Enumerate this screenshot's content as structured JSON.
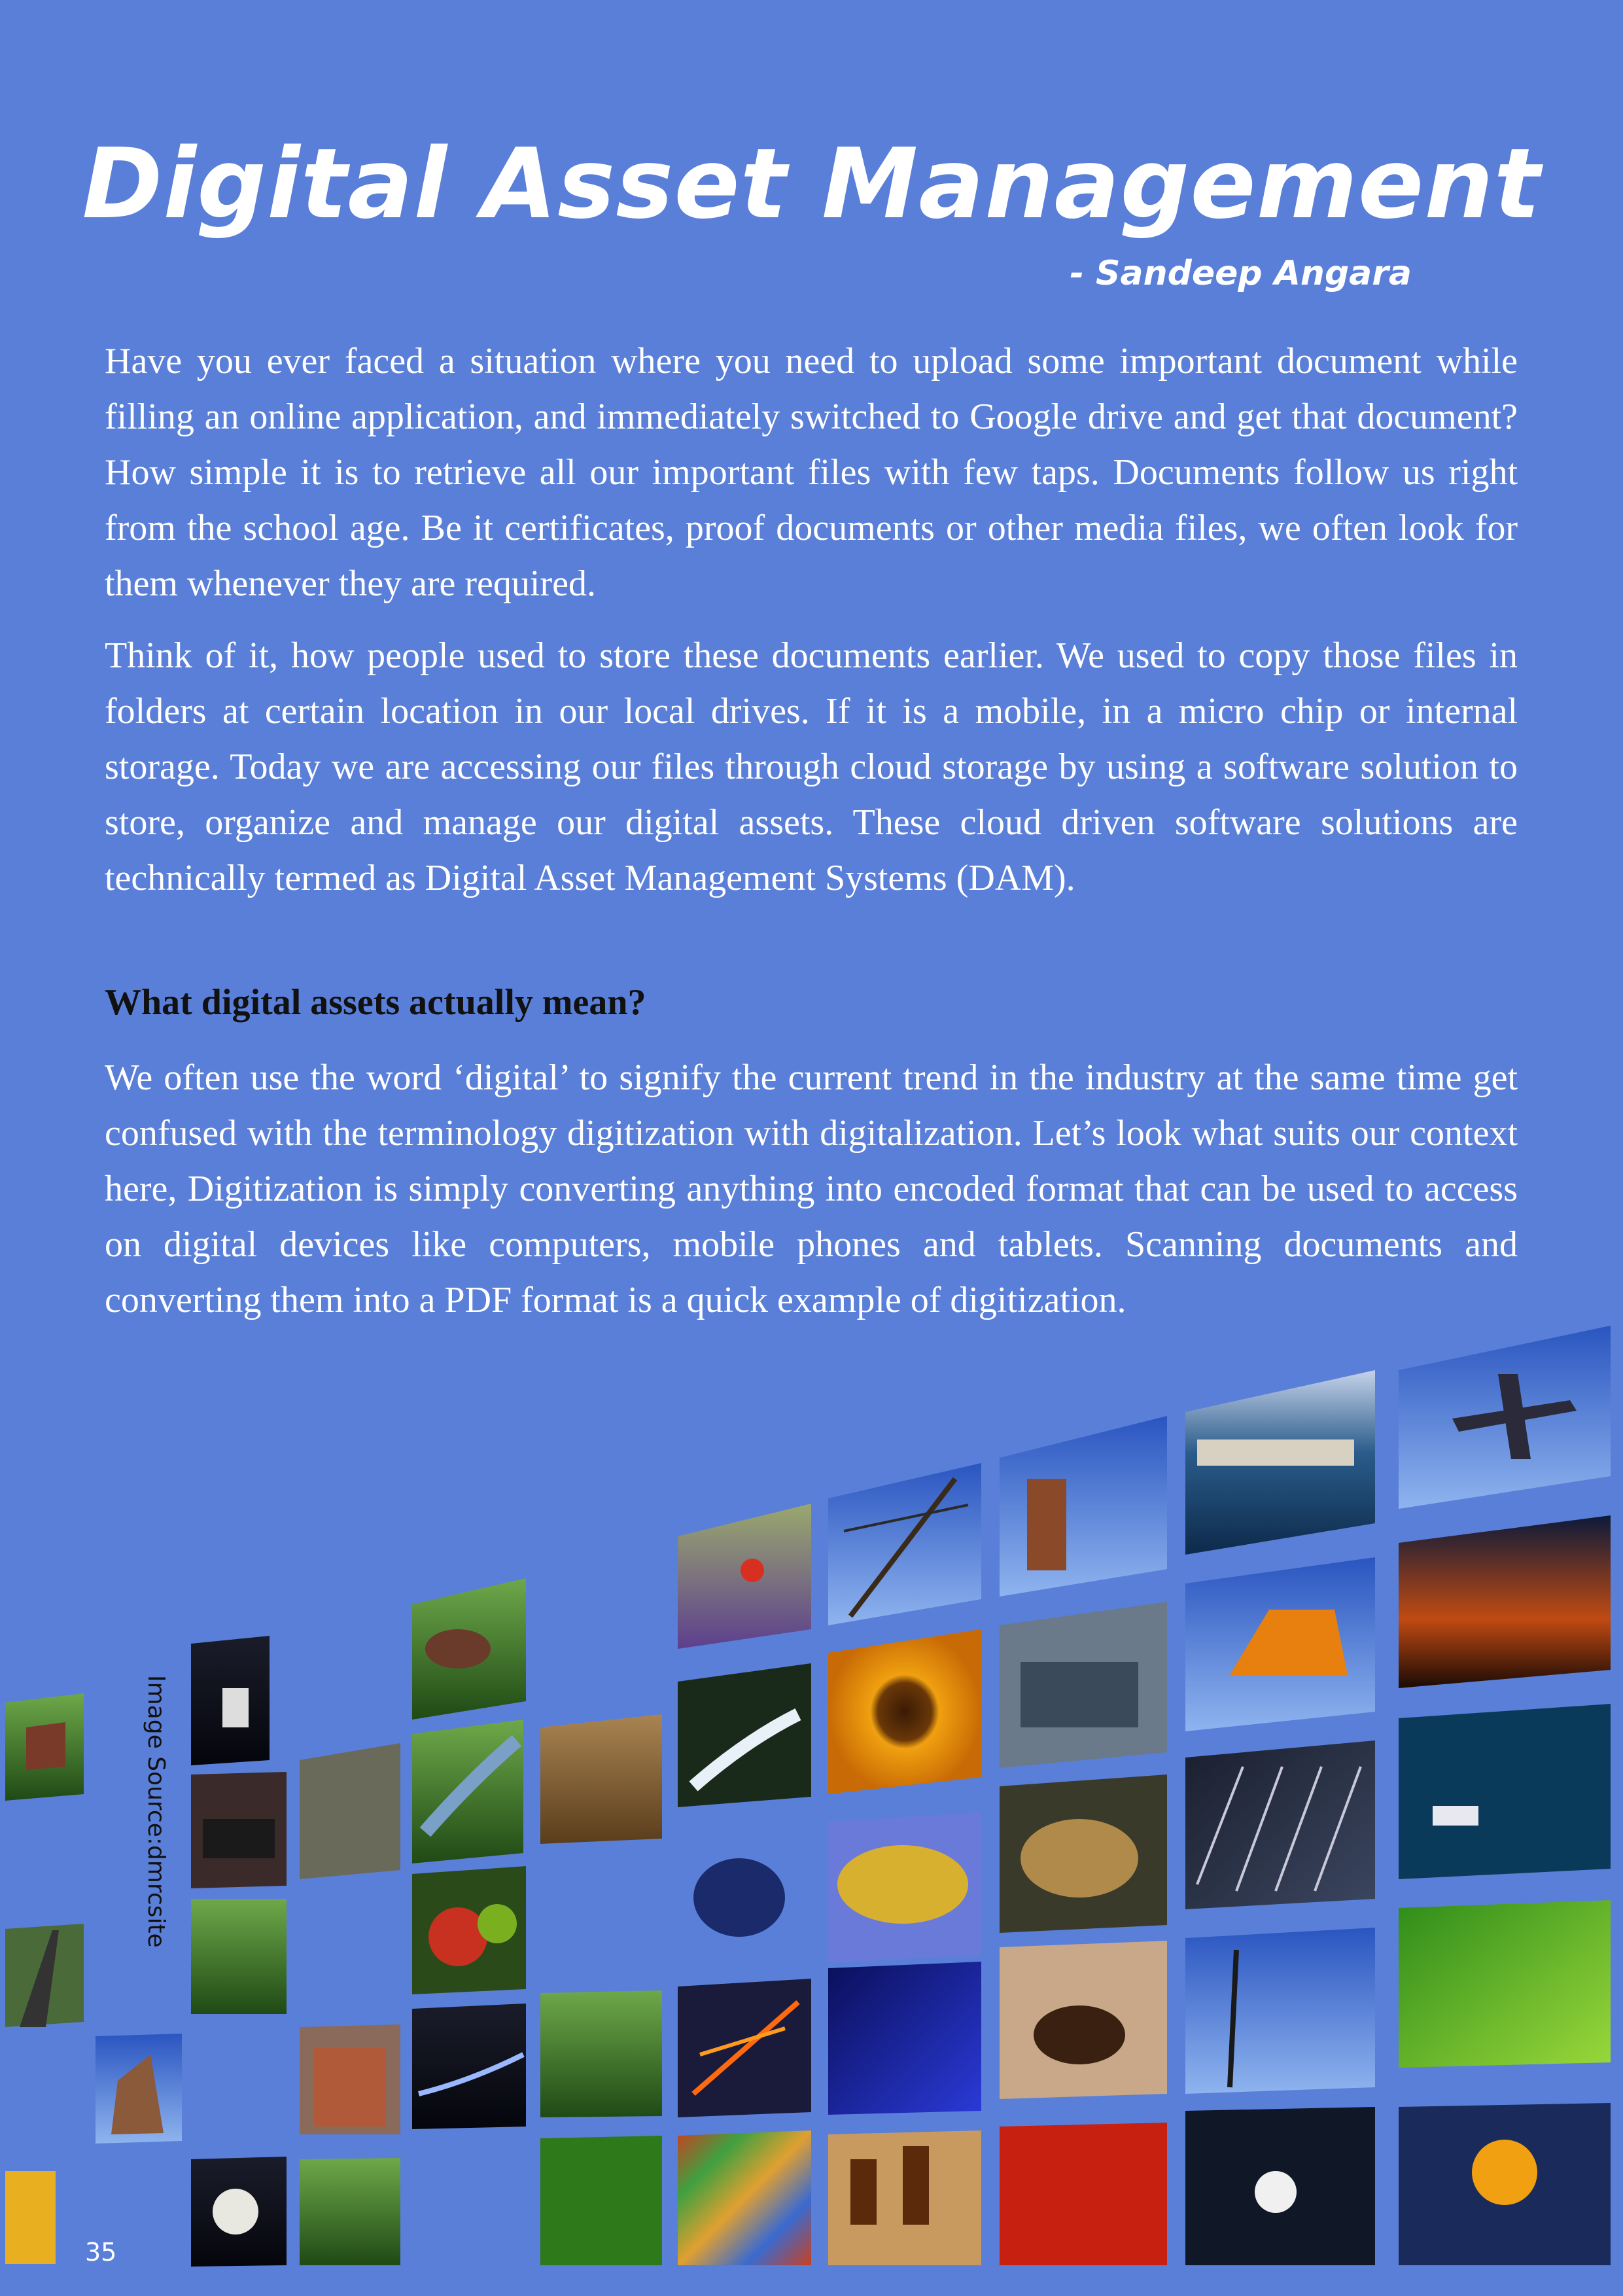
{
  "article": {
    "title": "Digital Asset Management",
    "author": "- Sandeep Angara",
    "paragraphs": [
      "Have you ever faced a situation where you need to upload some important document while filling an online application, and immediately switched to Google drive and get that document?  How simple it is to retrieve all our important files with few taps. Documents follow us right from the school age. Be it certificates, proof documents or other media files, we often look for them whenever they are required.",
      "Think of it, how people used to store these documents earlier. We used to copy those files in folders at certain location in our local drives. If it is a mobile, in a micro chip or internal storage. Today we are accessing our files through cloud storage by using a software solution to store, organize and manage our digital assets. These cloud driven software solutions are technically termed as Digital Asset Management Systems (DAM).",
      "We often use the word ‘digital’ to signify the current trend in the industry at the same time get confused with the terminology digitization with digitalization. Let’s look what suits our context here, Digitization is simply converting anything into encoded format that can be used to access on digital devices like computers, mobile phones and tablets. Scanning documents and converting them into a PDF format is a quick example of digitization."
    ],
    "section_heading": "What digital assets actually mean?"
  },
  "image": {
    "source_caption": "Image Source:dmrcsite",
    "description_icon": "photo-mosaic"
  },
  "footer": {
    "page_number": "35"
  },
  "colors": {
    "background": "#5a7fd8",
    "text": "#ffffff",
    "heading": "#111111"
  }
}
